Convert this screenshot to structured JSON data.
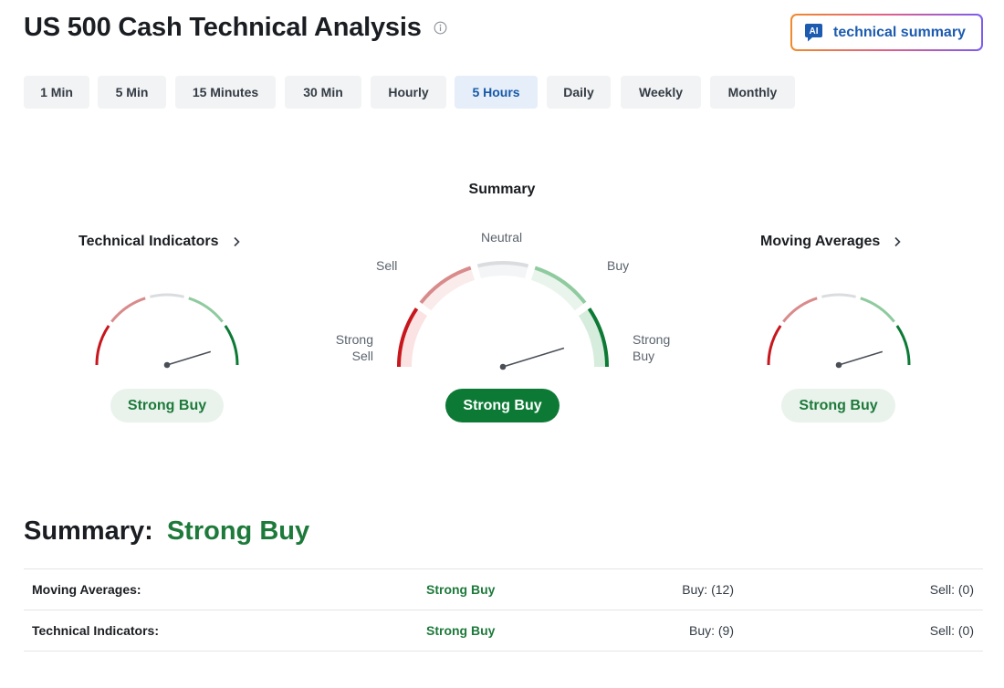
{
  "page": {
    "title": "US 500 Cash Technical Analysis"
  },
  "ai_button": {
    "badge": "AI",
    "label": "technical summary"
  },
  "timeframes": {
    "items": [
      "1 Min",
      "5 Min",
      "15 Minutes",
      "30 Min",
      "Hourly",
      "5 Hours",
      "Daily",
      "Weekly",
      "Monthly"
    ],
    "selected": "5 Hours"
  },
  "gauges": {
    "technical_indicators": {
      "title": "Technical Indicators",
      "result": "Strong Buy"
    },
    "summary": {
      "title": "Summary",
      "result": "Strong Buy",
      "scale_labels": {
        "strong_sell_1": "Strong",
        "strong_sell_2": "Sell",
        "sell": "Sell",
        "neutral": "Neutral",
        "buy": "Buy",
        "strong_buy_1": "Strong",
        "strong_buy_2": "Buy"
      }
    },
    "moving_averages": {
      "title": "Moving Averages",
      "result": "Strong Buy"
    }
  },
  "summary": {
    "label": "Summary:",
    "value": "Strong Buy",
    "rows": [
      {
        "name": "Moving Averages:",
        "signal": "Strong Buy",
        "buy": "Buy: (12)",
        "sell": "Sell: (0)"
      },
      {
        "name": "Technical Indicators:",
        "signal": "Strong Buy",
        "buy": "Buy: (9)",
        "sell": "Sell: (0)"
      }
    ]
  },
  "colors": {
    "strong_sell": "#c8161d",
    "sell": "#d98b8b",
    "neutral": "#dadcdf",
    "buy": "#8fcb9f",
    "strong_buy": "#0c7a35",
    "accent_blue": "#1759a8"
  }
}
